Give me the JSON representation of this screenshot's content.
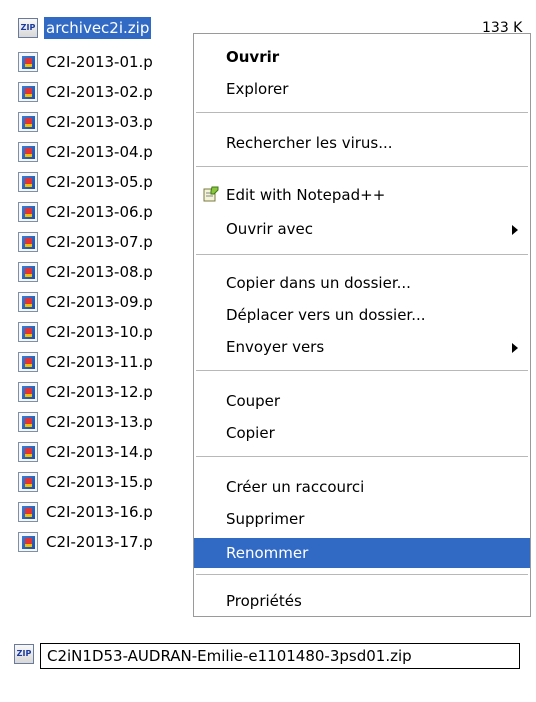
{
  "files": [
    {
      "name": "archivec2i.zip",
      "type": "zip",
      "selected": true,
      "size": "133 K"
    },
    {
      "name": "C2I-2013-01.p",
      "type": "pdf"
    },
    {
      "name": "C2I-2013-02.p",
      "type": "pdf"
    },
    {
      "name": "C2I-2013-03.p",
      "type": "pdf"
    },
    {
      "name": "C2I-2013-04.p",
      "type": "pdf"
    },
    {
      "name": "C2I-2013-05.p",
      "type": "pdf"
    },
    {
      "name": "C2I-2013-06.p",
      "type": "pdf"
    },
    {
      "name": "C2I-2013-07.p",
      "type": "pdf"
    },
    {
      "name": "C2I-2013-08.p",
      "type": "pdf"
    },
    {
      "name": "C2I-2013-09.p",
      "type": "pdf"
    },
    {
      "name": "C2I-2013-10.p",
      "type": "pdf"
    },
    {
      "name": "C2I-2013-11.p",
      "type": "pdf"
    },
    {
      "name": "C2I-2013-12.p",
      "type": "pdf"
    },
    {
      "name": "C2I-2013-13.p",
      "type": "pdf"
    },
    {
      "name": "C2I-2013-14.p",
      "type": "pdf"
    },
    {
      "name": "C2I-2013-15.p",
      "type": "pdf"
    },
    {
      "name": "C2I-2013-16.p",
      "type": "pdf"
    },
    {
      "name": "C2I-2013-17.p",
      "type": "pdf"
    }
  ],
  "zip_icon_text": "ZIP",
  "context_menu": {
    "open": "Ouvrir",
    "explore": "Explorer",
    "scan_virus": "Rechercher les virus...",
    "edit_notepad": "Edit with Notepad++",
    "open_with": "Ouvrir avec",
    "copy_to_folder": "Copier dans un dossier...",
    "move_to_folder": "Déplacer vers un dossier...",
    "send_to": "Envoyer vers",
    "cut": "Couper",
    "copy": "Copier",
    "create_shortcut": "Créer un raccourci",
    "delete": "Supprimer",
    "rename": "Renommer",
    "properties": "Propriétés"
  },
  "rename_box": {
    "value": "C2iN1D53-AUDRAN-Emilie-e1101480-3psd01.zip"
  },
  "colors": {
    "selection": "#316ac5",
    "menu_border": "#9a9a9a"
  }
}
